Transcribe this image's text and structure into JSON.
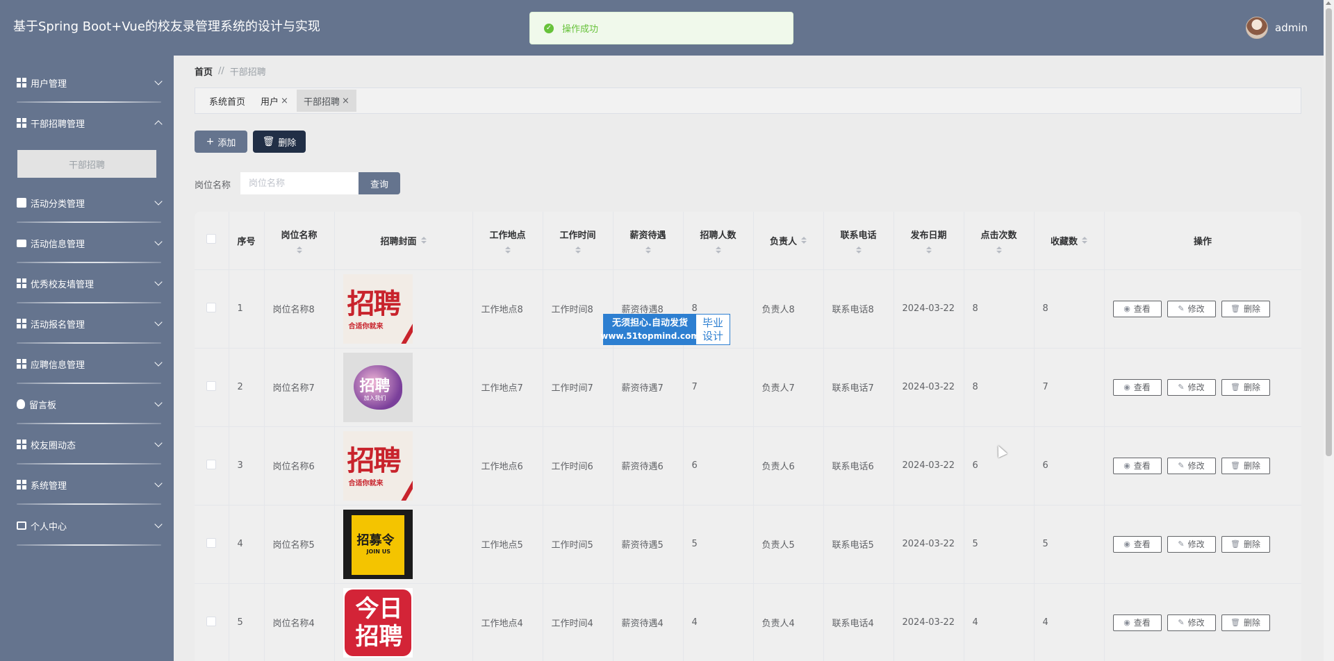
{
  "header": {
    "title": "基于Spring Boot+Vue的校友录管理系统的设计与实现",
    "username": "admin",
    "toast": "操作成功"
  },
  "sidebar": {
    "items": [
      {
        "label": "用户管理",
        "icon": "grid-icon",
        "expanded": false
      },
      {
        "label": "干部招聘管理",
        "icon": "grid-icon",
        "expanded": true
      },
      {
        "label": "活动分类管理",
        "icon": "clipboard-icon",
        "expanded": false
      },
      {
        "label": "活动信息管理",
        "icon": "message-icon",
        "expanded": false
      },
      {
        "label": "优秀校友墙管理",
        "icon": "grid-icon",
        "expanded": false
      },
      {
        "label": "活动报名管理",
        "icon": "grid-icon",
        "expanded": false
      },
      {
        "label": "应聘信息管理",
        "icon": "grid-icon",
        "expanded": false
      },
      {
        "label": "留言板",
        "icon": "bulb-icon",
        "expanded": false
      },
      {
        "label": "校友圈动态",
        "icon": "apps-icon",
        "expanded": false
      },
      {
        "label": "系统管理",
        "icon": "grid-icon",
        "expanded": false
      },
      {
        "label": "个人中心",
        "icon": "card-icon",
        "expanded": false
      }
    ],
    "submenu": "干部招聘"
  },
  "breadcrumb": {
    "home": "首页",
    "separator": "//",
    "current": "干部招聘"
  },
  "tabs": [
    {
      "label": "系统首页",
      "closable": false,
      "active": false
    },
    {
      "label": "用户",
      "closable": true,
      "active": false
    },
    {
      "label": "干部招聘",
      "closable": true,
      "active": true
    }
  ],
  "toolbar": {
    "add_label": "添加",
    "delete_label": "删除"
  },
  "search": {
    "label": "岗位名称",
    "placeholder": "岗位名称",
    "button": "查询"
  },
  "table": {
    "headers": {
      "index": "序号",
      "position": "岗位名称",
      "cover": "招聘封面",
      "location": "工作地点",
      "time": "工作时间",
      "salary": "薪资待遇",
      "count": "招聘人数",
      "manager": "负责人",
      "phone": "联系电话",
      "date": "发布日期",
      "clicks": "点击次数",
      "favorites": "收藏数",
      "actions": "操作"
    },
    "rows": [
      {
        "index": "1",
        "position": "岗位名称8",
        "cover_text": "招聘",
        "cover_sub": "合适你就来",
        "location": "工作地点8",
        "time": "工作时间8",
        "salary": "薪资待遇8",
        "count": "8",
        "manager": "负责人8",
        "phone": "联系电话8",
        "date": "2024-03-22",
        "clicks": "8",
        "favorites": "8"
      },
      {
        "index": "2",
        "position": "岗位名称7",
        "cover_text": "招聘",
        "cover_sub": "加入我们",
        "location": "工作地点7",
        "time": "工作时间7",
        "salary": "薪资待遇7",
        "count": "7",
        "manager": "负责人7",
        "phone": "联系电话7",
        "date": "2024-03-22",
        "clicks": "8",
        "favorites": "7"
      },
      {
        "index": "3",
        "position": "岗位名称6",
        "cover_text": "招聘",
        "cover_sub": "合适你就来",
        "location": "工作地点6",
        "time": "工作时间6",
        "salary": "薪资待遇6",
        "count": "6",
        "manager": "负责人6",
        "phone": "联系电话6",
        "date": "2024-03-22",
        "clicks": "6",
        "favorites": "6"
      },
      {
        "index": "4",
        "position": "岗位名称5",
        "cover_text": "招募令",
        "cover_sub": "JOIN US",
        "location": "工作地点5",
        "time": "工作时间5",
        "salary": "薪资待遇5",
        "count": "5",
        "manager": "负责人5",
        "phone": "联系电话5",
        "date": "2024-03-22",
        "clicks": "5",
        "favorites": "5"
      },
      {
        "index": "5",
        "position": "岗位名称4",
        "cover_text": "今日招聘",
        "cover_sub": "",
        "location": "工作地点4",
        "time": "工作时间4",
        "salary": "薪资待遇4",
        "count": "4",
        "manager": "负责人4",
        "phone": "联系电话4",
        "date": "2024-03-22",
        "clicks": "4",
        "favorites": "4"
      }
    ],
    "actions": {
      "view": "查看",
      "edit": "修改",
      "delete": "删除"
    }
  },
  "watermark": {
    "line1": "无须担心.自动发货",
    "line2": "www.51topmind.com",
    "right1": "毕业",
    "right2": "设计"
  },
  "colors": {
    "primary": "#65748e",
    "dark_button": "#212f46",
    "success": "#67c23a",
    "watermark": "#2d7fd1"
  }
}
